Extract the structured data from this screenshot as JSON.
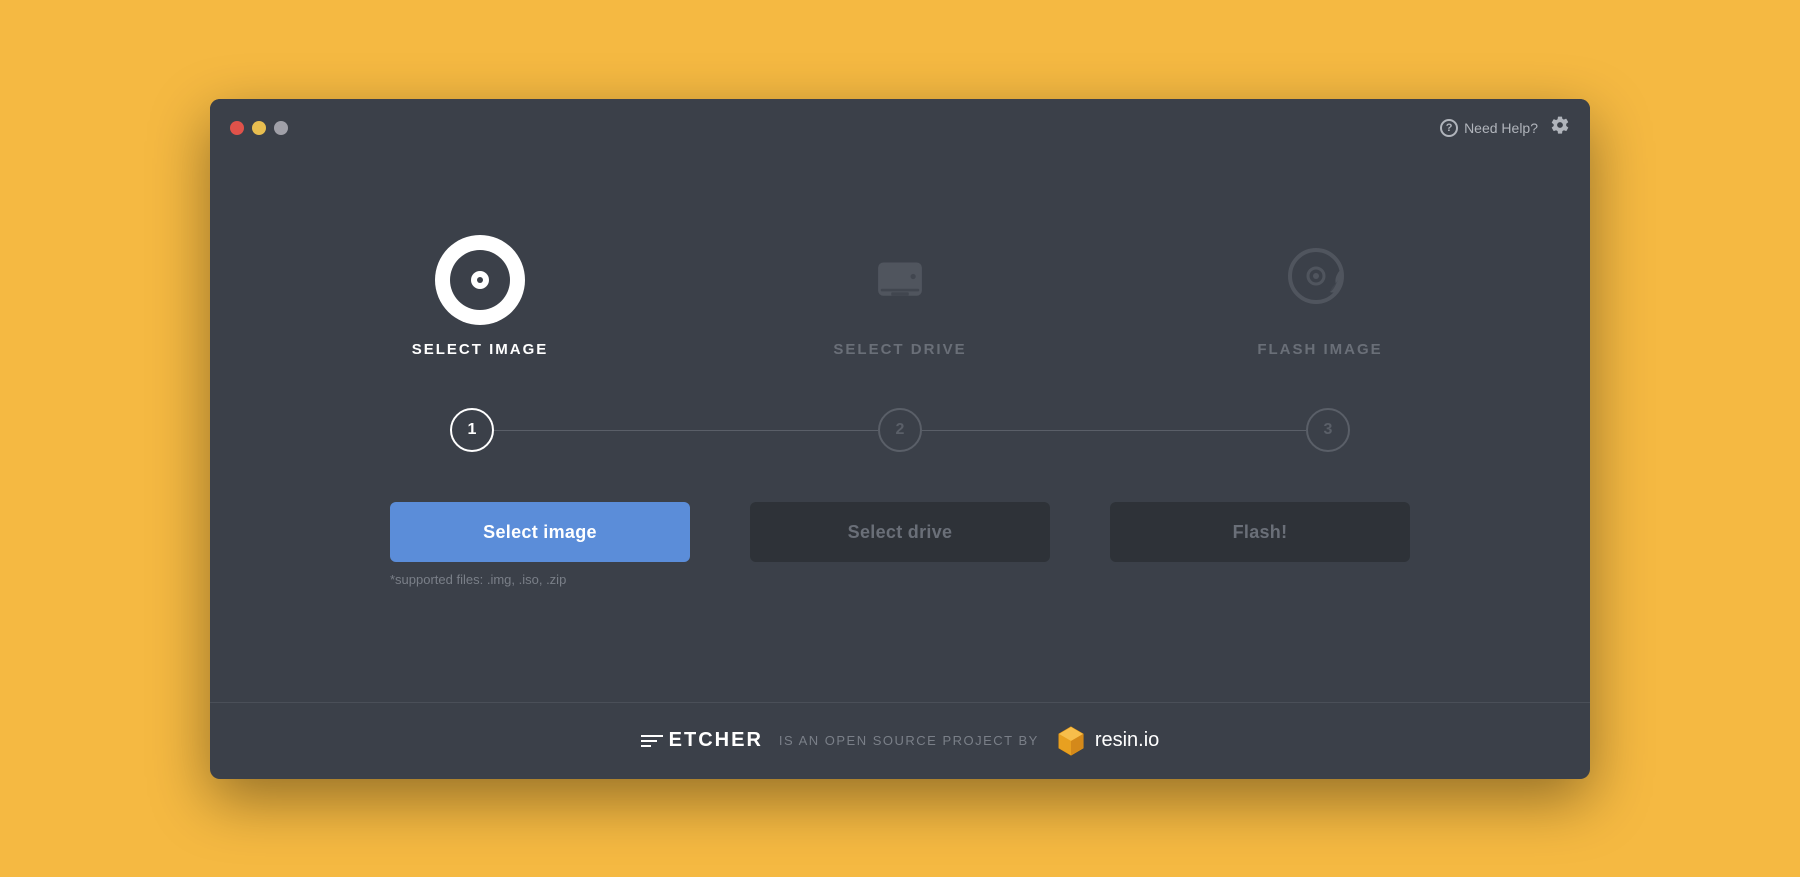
{
  "window": {
    "title": "Etcher"
  },
  "titlebar": {
    "traffic_lights": [
      "close",
      "minimize",
      "maximize"
    ],
    "help_label": "Need Help?",
    "settings_icon": "⚙"
  },
  "steps": [
    {
      "id": "select-image",
      "icon_type": "disc",
      "label": "SELECT IMAGE",
      "number": "1",
      "state": "active"
    },
    {
      "id": "select-drive",
      "icon_type": "drive",
      "label": "SELECT DRIVE",
      "number": "2",
      "state": "inactive"
    },
    {
      "id": "flash-image",
      "icon_type": "flash",
      "label": "FLASH IMAGE",
      "number": "3",
      "state": "inactive"
    }
  ],
  "buttons": {
    "select_image": "Select image",
    "select_drive": "Select drive",
    "flash": "Flash!"
  },
  "supported_files": "*supported files: .img, .iso, .zip",
  "footer": {
    "etcher_label": "ETCHER",
    "middle_text": "IS AN OPEN SOURCE PROJECT BY",
    "resin_label": "resin.io"
  }
}
